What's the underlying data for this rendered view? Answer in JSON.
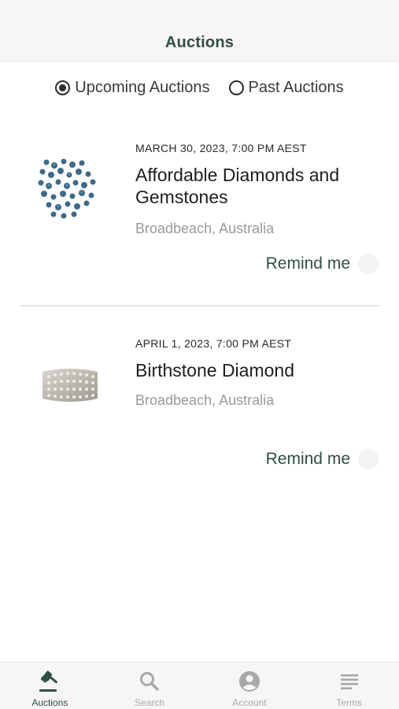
{
  "header": {
    "title": "Auctions"
  },
  "filter": {
    "options": [
      {
        "label": "Upcoming Auctions",
        "selected": true
      },
      {
        "label": "Past Auctions",
        "selected": false
      }
    ]
  },
  "auctions": [
    {
      "date": "MARCH 30, 2023, 7:00 PM AEST",
      "title": "Affordable Diamonds and Gemstones",
      "location": "Broadbeach, Australia",
      "remind_label": "Remind me",
      "image": "blue-gemstones-icon"
    },
    {
      "date": "APRIL 1, 2023, 7:00 PM AEST",
      "title": "Birthstone Diamond",
      "location": "Broadbeach, Australia",
      "remind_label": "Remind me",
      "image": "diamond-ring-icon"
    }
  ],
  "tabs": [
    {
      "label": "Auctions",
      "icon": "gavel-icon",
      "active": true
    },
    {
      "label": "Search",
      "icon": "search-icon",
      "active": false
    },
    {
      "label": "Account",
      "icon": "account-icon",
      "active": false
    },
    {
      "label": "Terms",
      "icon": "terms-icon",
      "active": false
    }
  ],
  "colors": {
    "accent": "#2f4f45",
    "header_bg": "#f8f5f5",
    "muted_text": "#9a9a9a",
    "inactive_tab": "#a8a8a8"
  }
}
